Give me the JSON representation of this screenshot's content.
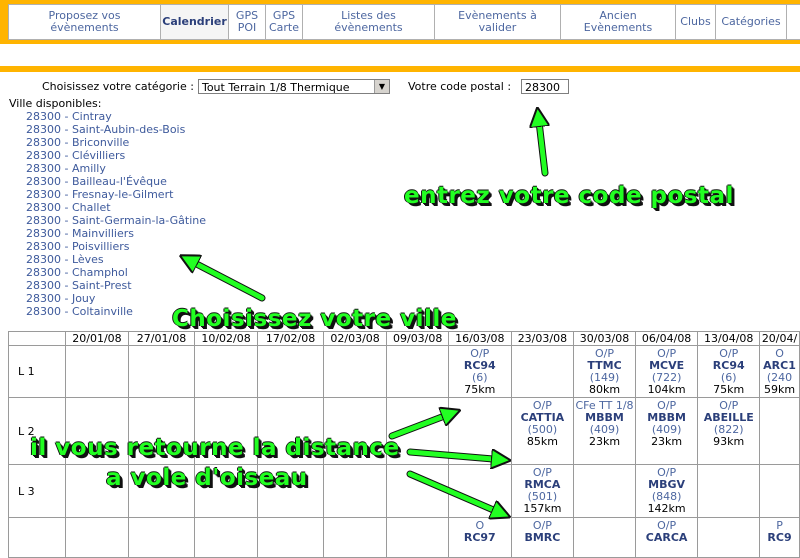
{
  "nav": {
    "items": [
      {
        "label": "Proposez vos évènements",
        "width": 152
      },
      {
        "label": "Calendrier",
        "width": 68,
        "active": true
      },
      {
        "label": "GPS POI",
        "width": 37
      },
      {
        "label": "GPS Carte",
        "width": 37
      },
      {
        "label": "Listes des évènements",
        "width": 132
      },
      {
        "label": "Evènements à valider",
        "width": 126
      },
      {
        "label": "Ancien Evènements",
        "width": 115
      },
      {
        "label": "Clubs",
        "width": 40
      },
      {
        "label": "Catégories",
        "width": 71
      }
    ]
  },
  "form": {
    "category_label": "Choisissez votre catégorie :",
    "category_value": "Tout Terrain 1/8 Thermique",
    "postal_label": "Votre code postal :",
    "postal_value": "28300",
    "cities_label": "Ville disponibles:"
  },
  "cities": [
    "28300 - Cintray",
    "28300 - Saint-Aubin-des-Bois",
    "28300 - Briconville",
    "28300 - Clévilliers",
    "28300 - Amilly",
    "28300 - Bailleau-l'Évêque",
    "28300 - Fresnay-le-Gilmert",
    "28300 - Challet",
    "28300 - Saint-Germain-la-Gâtine",
    "28300 - Mainvilliers",
    "28300 - Poisvilliers",
    "28300 - Lèves",
    "28300 - Champhol",
    "28300 - Saint-Prest",
    "28300 - Jouy",
    "28300 - Coltainville"
  ],
  "calendar": {
    "dates": [
      "20/01/08",
      "27/01/08",
      "10/02/08",
      "17/02/08",
      "02/03/08",
      "09/03/08",
      "16/03/08",
      "23/03/08",
      "30/03/08",
      "06/04/08",
      "13/04/08",
      "20/04/"
    ],
    "rows": [
      {
        "label": "L 1",
        "cells": [
          null,
          null,
          null,
          null,
          null,
          null,
          {
            "type": "O/P",
            "club": "RC94",
            "count": "(6)",
            "dist": "75km"
          },
          null,
          {
            "type": "O/P",
            "club": "TTMC",
            "count": "(149)",
            "dist": "80km"
          },
          {
            "type": "O/P",
            "club": "MCVE",
            "count": "(722)",
            "dist": "104km"
          },
          {
            "type": "O/P",
            "club": "RC94",
            "count": "(6)",
            "dist": "75km"
          },
          {
            "type": "O",
            "club": "ARC1",
            "count": "(240",
            "dist": "59km"
          }
        ]
      },
      {
        "label": "L 2",
        "cells": [
          null,
          null,
          null,
          null,
          null,
          null,
          null,
          {
            "type": "O/P",
            "club": "CATTIA",
            "count": "(500)",
            "dist": "85km"
          },
          {
            "type": "CFe TT 1/8",
            "club": "MBBM",
            "count": "(409)",
            "dist": "23km"
          },
          {
            "type": "O/P",
            "club": "MBBM",
            "count": "(409)",
            "dist": "23km"
          },
          {
            "type": "O/P",
            "club": "ABEILLE",
            "count": "(822)",
            "dist": "93km"
          },
          null
        ]
      },
      {
        "label": "L 3",
        "cells": [
          null,
          null,
          null,
          null,
          null,
          null,
          null,
          {
            "type": "O/P",
            "club": "RMCA",
            "count": "(501)",
            "dist": "157km"
          },
          null,
          {
            "type": "O/P",
            "club": "MBGV",
            "count": "(848)",
            "dist": "142km"
          },
          null,
          null
        ]
      },
      {
        "label": "",
        "cells": [
          null,
          null,
          null,
          null,
          null,
          null,
          {
            "type": "O",
            "club": "RC97",
            "count": "",
            "dist": ""
          },
          {
            "type": "O/P",
            "club": "BMRC",
            "count": "",
            "dist": ""
          },
          null,
          {
            "type": "O/P",
            "club": "CARCA",
            "count": "",
            "dist": ""
          },
          null,
          {
            "type": "P",
            "club": "RC9",
            "count": "",
            "dist": ""
          }
        ]
      }
    ]
  },
  "annotations": {
    "postal": "entrez votre code postal",
    "ville": "Choisissez votre ville",
    "distance_line1": "il vous retourne la distance",
    "distance_line2": "a vole d'oiseau"
  },
  "colors": {
    "frame_orange": "#ffb400",
    "link_blue": "#3e5a9c",
    "annotation_green": "#22ff22"
  }
}
